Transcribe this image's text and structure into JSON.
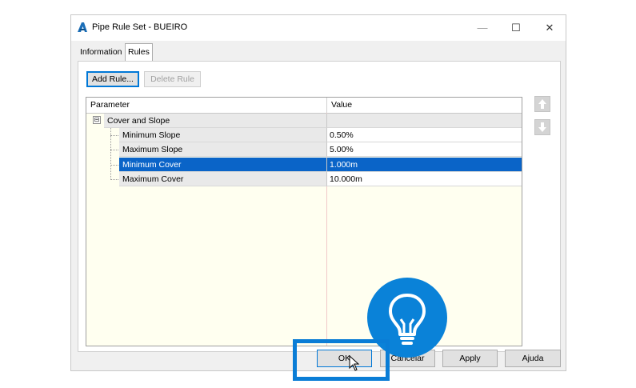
{
  "window": {
    "title": "Pipe Rule Set - BUEIRO",
    "app_icon": "autodesk-a-icon",
    "minimize_glyph": "—",
    "maximize_glyph": "☐",
    "close_glyph": "✕"
  },
  "tabs": [
    {
      "label": "Information",
      "active": false
    },
    {
      "label": "Rules",
      "active": true
    }
  ],
  "toolbar": {
    "add_rule_label": "Add Rule...",
    "delete_rule_label": "Delete Rule"
  },
  "grid": {
    "headers": {
      "parameter": "Parameter",
      "value": "Value"
    },
    "group": {
      "label": "Cover and Slope",
      "expander": "⊟"
    },
    "rows": [
      {
        "parameter": "Minimum Slope",
        "value": "0.50%",
        "selected": false
      },
      {
        "parameter": "Maximum Slope",
        "value": "5.00%",
        "selected": false
      },
      {
        "parameter": "Minimum Cover",
        "value": "1.000m",
        "selected": true
      },
      {
        "parameter": "Maximum Cover",
        "value": "10.000m",
        "selected": false
      }
    ]
  },
  "side_buttons": {
    "move_up": "arrow-up-icon",
    "move_down": "arrow-down-icon"
  },
  "footer": {
    "ok_label": "OK",
    "cancel_label": "Cancelar",
    "apply_label": "Apply",
    "help_label": "Ajuda"
  },
  "colors": {
    "accent": "#0a7dd6",
    "selection": "#0a64c8",
    "grid_background": "#fffff0"
  },
  "overlay": {
    "icon": "lightbulb-icon"
  }
}
